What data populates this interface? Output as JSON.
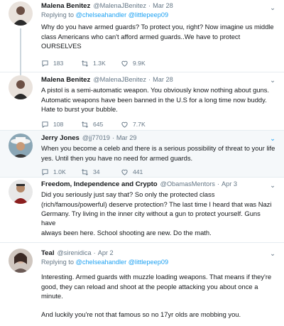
{
  "tweets": [
    {
      "name": "Malena Benitez",
      "handle": "@MalenaJBenitez",
      "time": "Mar 28",
      "reply_prefix": "Replying to",
      "reply_to": "@chelseahandler @littlepeep09",
      "lines": [
        "Why do you have armed guards? To protect you, right? Now imagine us middle",
        "class Americans who can't afford armed guards..We have to protect",
        "OURSELVES"
      ],
      "replies": "183",
      "retweets": "1.3K",
      "likes": "9.9K"
    },
    {
      "name": "Malena Benitez",
      "handle": "@MalenaJBenitez",
      "time": "Mar 28",
      "lines": [
        "A pistol is a semi-automatic weapon. You obviously know nothing about guns.",
        "Automatic weapons have been banned in the U.S for a long time now buddy.",
        "Hate to burst your bubble."
      ],
      "replies": "108",
      "retweets": "645",
      "likes": "7.7K"
    },
    {
      "name": "Jerry Jones",
      "handle": "@jj77019",
      "time": "Mar 29",
      "lines": [
        "When you become a celeb and there is a serious possibility of threat to your life",
        "yes.  Until then you have no need for armed guards."
      ],
      "replies": "1.0K",
      "retweets": "34",
      "likes": "441"
    },
    {
      "name": "Freedom, Independence and Crypto",
      "handle": "@ObamasMentors",
      "time": "Apr 3",
      "lines": [
        "Did you seriously just say that? So only the protected class",
        "(rich/famous/powerful) deserve protection? The last time I heard that was Nazi",
        "Germany. Try living in the inner city without a gun to protect yourself. Guns have",
        "always been here. School shooting are new. Do the math."
      ],
      "replies": "",
      "retweets": "",
      "likes": ""
    },
    {
      "name": "Teal",
      "handle": "@sirenidica",
      "time": "Apr 2",
      "reply_prefix": "Replying to",
      "reply_to": "@chelseahandler @littlepeep09",
      "lines": [
        "Interesting. Armed guards with muzzle loading weapons. That means if they're",
        "good, they can reload and shoot at the people attacking you about once a",
        "minute.",
        "",
        "And luckily you're not that famous so no 17yr olds are mobbing you."
      ]
    }
  ],
  "colors": {
    "link": "#1da1f2",
    "muted": "#657786",
    "highlight_bg": "#f5f8fa",
    "border": "#e6ecf0"
  },
  "icons": [
    "reply-icon",
    "retweet-icon",
    "like-icon",
    "chevron-down-icon"
  ]
}
